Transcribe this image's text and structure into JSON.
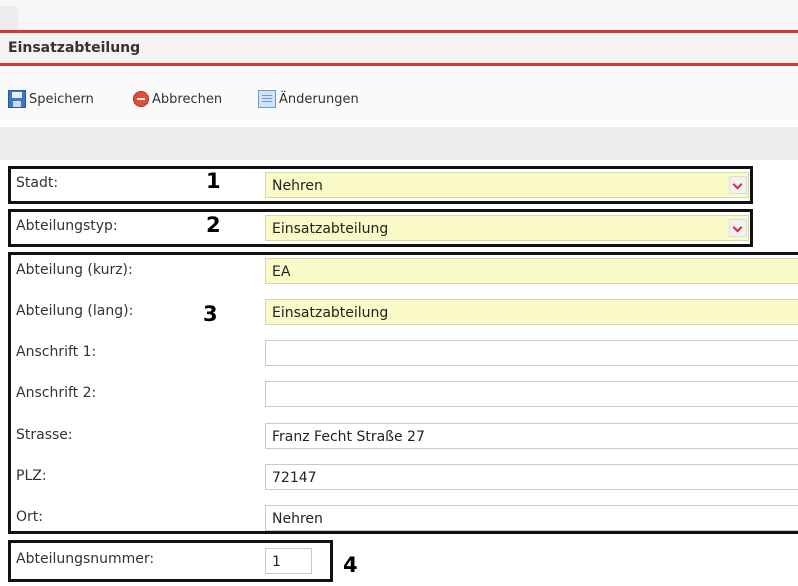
{
  "header": {
    "title": "Einsatzabteilung"
  },
  "toolbar": {
    "save": "Speichern",
    "cancel": "Abbrechen",
    "changes": "Änderungen"
  },
  "form": {
    "stadt": {
      "label": "Stadt:",
      "value": "Nehren"
    },
    "abteilungstyp": {
      "label": "Abteilungstyp:",
      "value": "Einsatzabteilung"
    },
    "abteilung_kurz": {
      "label": "Abteilung (kurz):",
      "value": "EA"
    },
    "abteilung_lang": {
      "label": "Abteilung (lang):",
      "value": "Einsatzabteilung"
    },
    "anschrift1": {
      "label": "Anschrift 1:",
      "value": ""
    },
    "anschrift2": {
      "label": "Anschrift 2:",
      "value": ""
    },
    "strasse": {
      "label": "Strasse:",
      "value": "Franz Fecht Straße 27"
    },
    "plz": {
      "label": "PLZ:",
      "value": "72147"
    },
    "ort": {
      "label": "Ort:",
      "value": "Nehren"
    },
    "abteilungsnummer": {
      "label": "Abteilungsnummer:",
      "value": "1"
    }
  },
  "annotations": {
    "n1": "1",
    "n2": "2",
    "n3": "3",
    "n4": "4"
  },
  "colors": {
    "accent_red": "#d13838",
    "required_field": "#fafac8"
  }
}
